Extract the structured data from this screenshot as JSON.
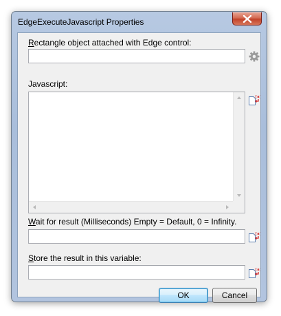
{
  "window": {
    "title": "EdgeExecuteJavascript Properties"
  },
  "fields": {
    "rectangle": {
      "label_mnemonic": "R",
      "label_rest": "ectangle object attached with Edge control:",
      "value": ""
    },
    "javascript": {
      "label": "Javascript:",
      "value": ""
    },
    "wait": {
      "label_mnemonic": "W",
      "label_rest": "ait for result (Milliseconds) Empty = Default, 0 = Infinity.",
      "value": ""
    },
    "store": {
      "label_mnemonic": "S",
      "label_rest": "tore the result in this variable:",
      "value": ""
    }
  },
  "buttons": {
    "ok": "OK",
    "cancel": "Cancel"
  },
  "icons": {
    "close": "close-icon",
    "settings": "gear-icon",
    "variable": "variable-insert-icon"
  },
  "colors": {
    "frame": "#b7c9e2",
    "client": "#f0f0f0",
    "close": "#c2432a",
    "variable_marker": "#d42020"
  }
}
